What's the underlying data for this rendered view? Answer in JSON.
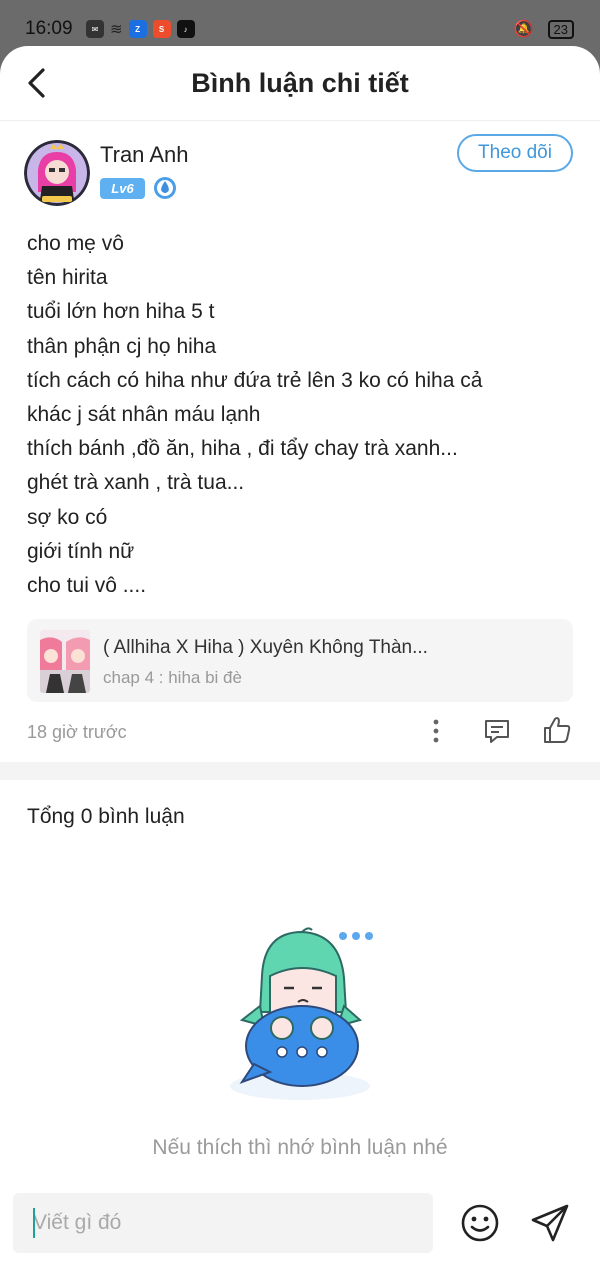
{
  "status_bar": {
    "time": "16:09",
    "battery": "23",
    "notif_icons": [
      "zalo-icon",
      "shopee-icon",
      "tiktok-icon"
    ]
  },
  "header": {
    "title": "Bình luận chi tiết"
  },
  "author": {
    "name": "Tran Anh",
    "level": "Lv6",
    "follow_label": "Theo dõi"
  },
  "post": {
    "lines": [
      "cho mẹ vô",
      "tên hirita",
      "tuổi lớn hơn hiha 5 t",
      "thân phận cj họ hiha",
      "tích cách có hiha như đứa trẻ lên 3 ko có hiha cả",
      "khác j sát nhân máu lạnh",
      "thích bánh ,đồ ăn, hiha , đi tẩy chay trà xanh...",
      "ghét trà xanh , trà tua...",
      "sợ ko có",
      "giới tính nữ",
      "cho tui vô ...."
    ],
    "linked_story": {
      "title": "( Allhiha X Hiha ) Xuyên Không Thàn...",
      "chapter": "chap 4 : hiha bi đè"
    },
    "time_ago": "18 giờ trước"
  },
  "comments": {
    "total_label": "Tổng 0 bình luận",
    "empty_text": "Nếu thích thì nhớ bình luận nhé"
  },
  "input_bar": {
    "placeholder": "Viết gì đó"
  },
  "colors": {
    "accent": "#3f97dc",
    "level_badge": "#5fb0f0",
    "mascot_hair": "#5fd6b0",
    "mascot_body": "#3a8ee8"
  }
}
